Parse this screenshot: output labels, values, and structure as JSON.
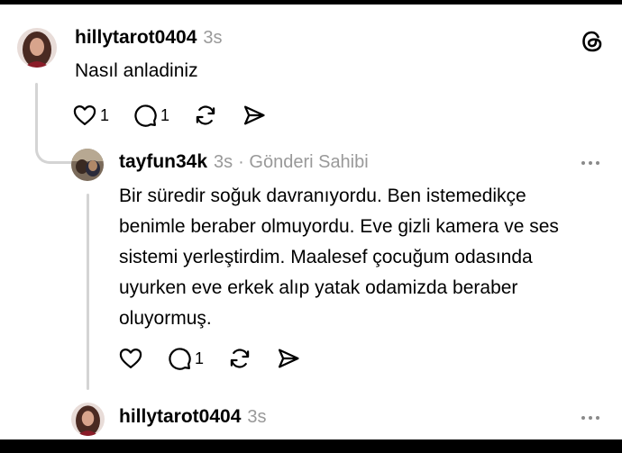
{
  "posts": [
    {
      "username": "hillytarot0404",
      "time": "3s",
      "text": "Nasıl anladiniz",
      "likes": "1",
      "replies": "1"
    },
    {
      "username": "tayfun34k",
      "time": "3s",
      "meta": "· Gönderi Sahibi",
      "text": "Bir süredir soğuk davranıyordu. Ben istemedikçe benimle beraber olmuyordu. Eve gizli kamera ve ses sistemi yerleştirdim. Maalesef çocuğum odasında uyurken eve erkek alıp yatak odamizda beraber oluyormuş.",
      "replies": "1"
    },
    {
      "username": "hillytarot0404",
      "time": "3s"
    }
  ],
  "icons": [
    "threads-logo-icon",
    "heart-icon",
    "comment-icon",
    "repost-icon",
    "share-icon",
    "more-icon"
  ]
}
